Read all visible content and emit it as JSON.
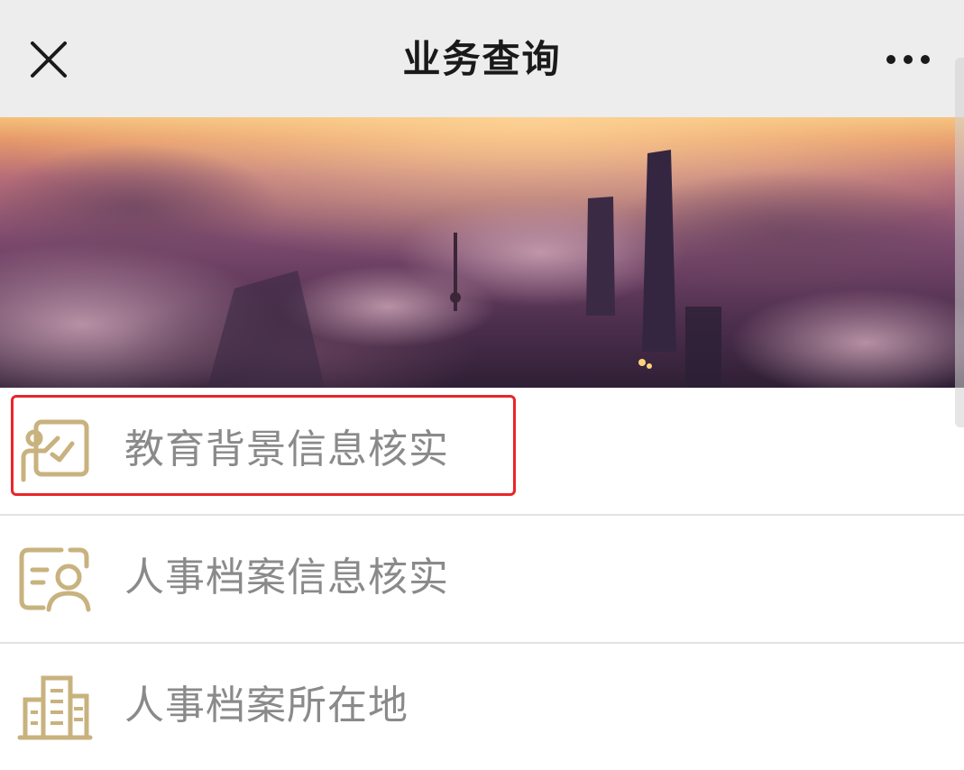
{
  "navbar": {
    "title": "业务查询",
    "close_icon": "close-icon",
    "more_icon": "more-dots-icon"
  },
  "banner": {
    "image": "city-skyline-sunrise-clouds"
  },
  "menu": {
    "items": [
      {
        "label": "教育背景信息核实",
        "icon": "education-board-icon",
        "highlighted": true
      },
      {
        "label": "人事档案信息核实",
        "icon": "profile-card-icon",
        "highlighted": false
      },
      {
        "label": "人事档案所在地",
        "icon": "building-icon",
        "highlighted": false
      }
    ]
  },
  "colors": {
    "navbar_bg": "#ededed",
    "icon_gold": "#c8b27e",
    "label_gray": "#8a8a8a",
    "highlight_red": "#e8262a"
  }
}
